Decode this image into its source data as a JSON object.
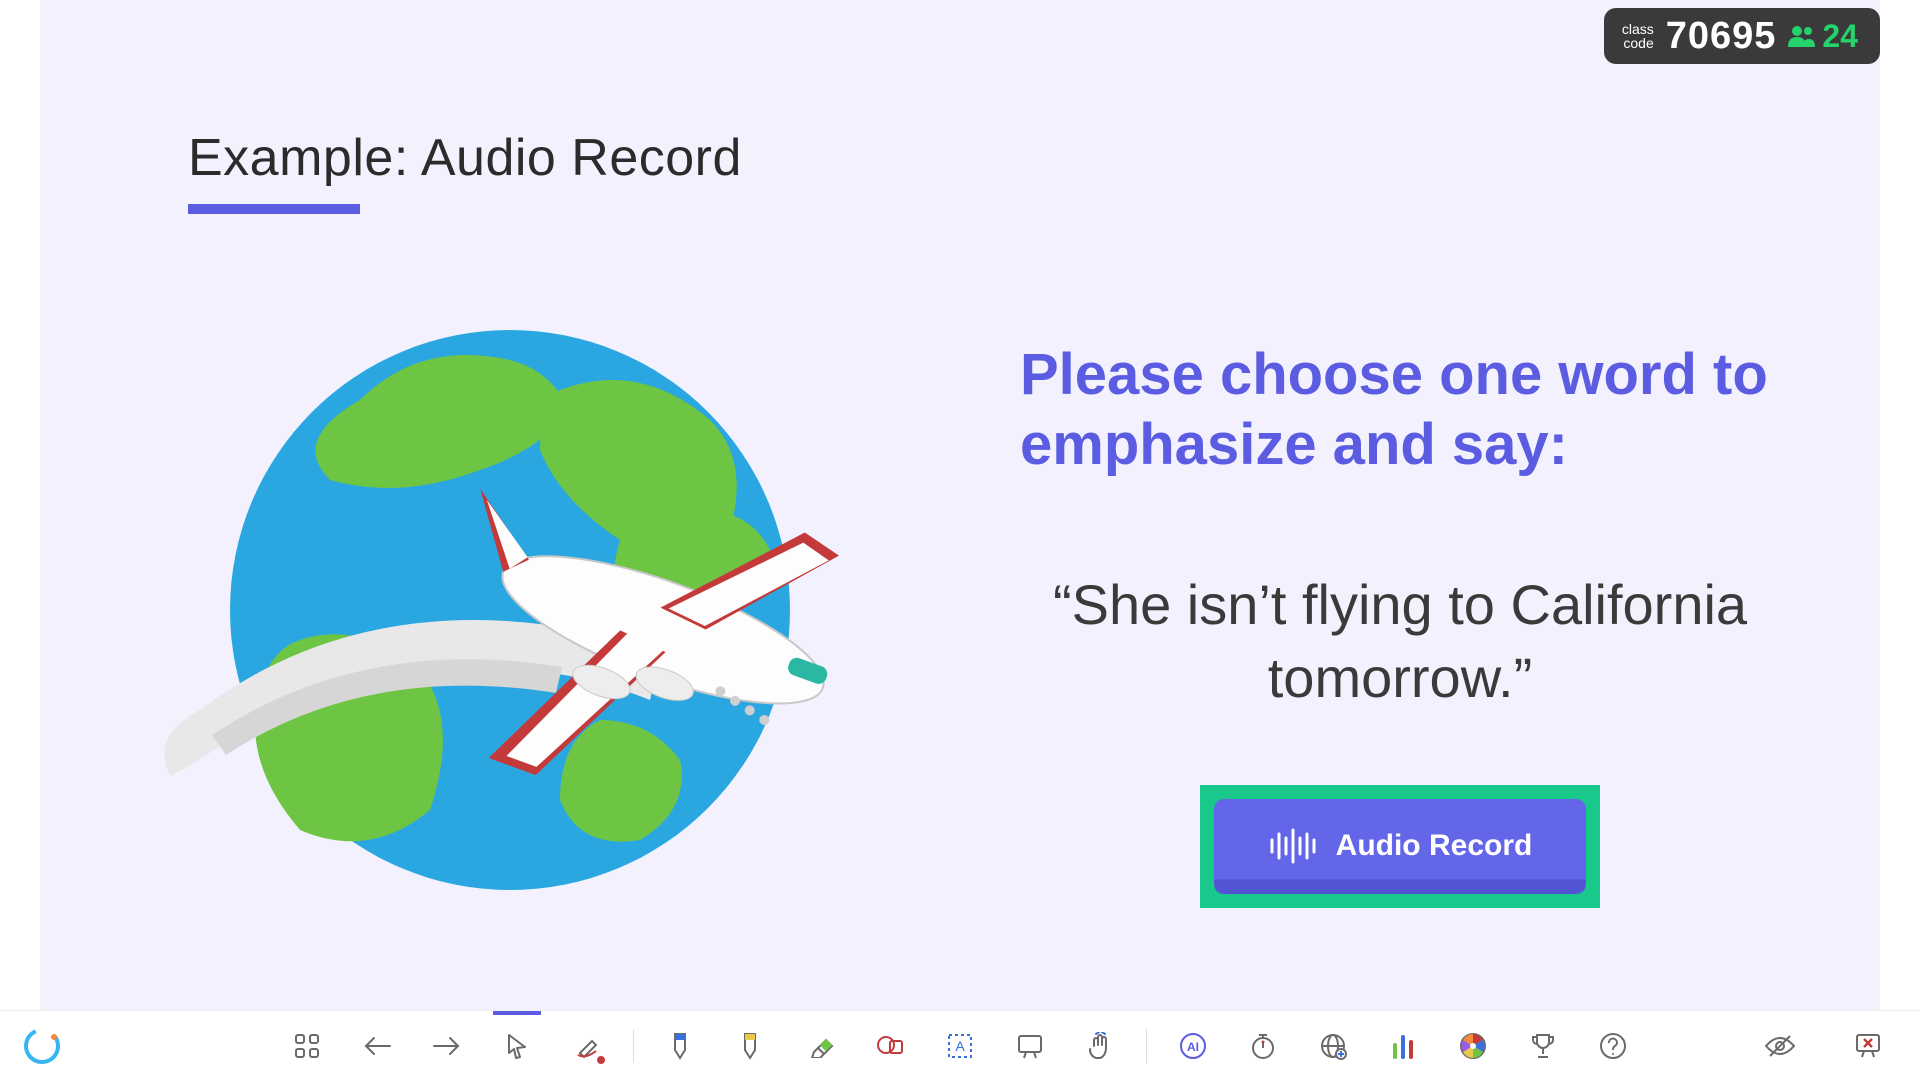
{
  "header": {
    "class_label_l1": "class",
    "class_label_l2": "code",
    "class_code": "70695",
    "participant_count": "24"
  },
  "slide": {
    "title": "Example: Audio Record",
    "prompt": "Please choose one word to emphasize and say:",
    "quote": "“She isn’t flying to California tomorrow.”",
    "audio_button_label": "Audio Record"
  },
  "toolbar": {
    "logo": "C",
    "items": {
      "grid": "grid-view",
      "prev": "previous",
      "next": "next",
      "pointer": "pointer",
      "marker": "marker",
      "highlighter_blue": "highlighter",
      "highlighter_yellow": "highlighter",
      "eraser": "eraser",
      "lasso": "lasso",
      "textbox": "text-box",
      "whiteboard": "whiteboard",
      "drag": "drag-hand",
      "ai": "ai-assist",
      "timer": "timer",
      "web": "web",
      "poll": "poll",
      "spinner": "spinner",
      "trophy": "trophy",
      "help": "help",
      "hide": "hide-eye",
      "end": "end-presentation"
    }
  }
}
